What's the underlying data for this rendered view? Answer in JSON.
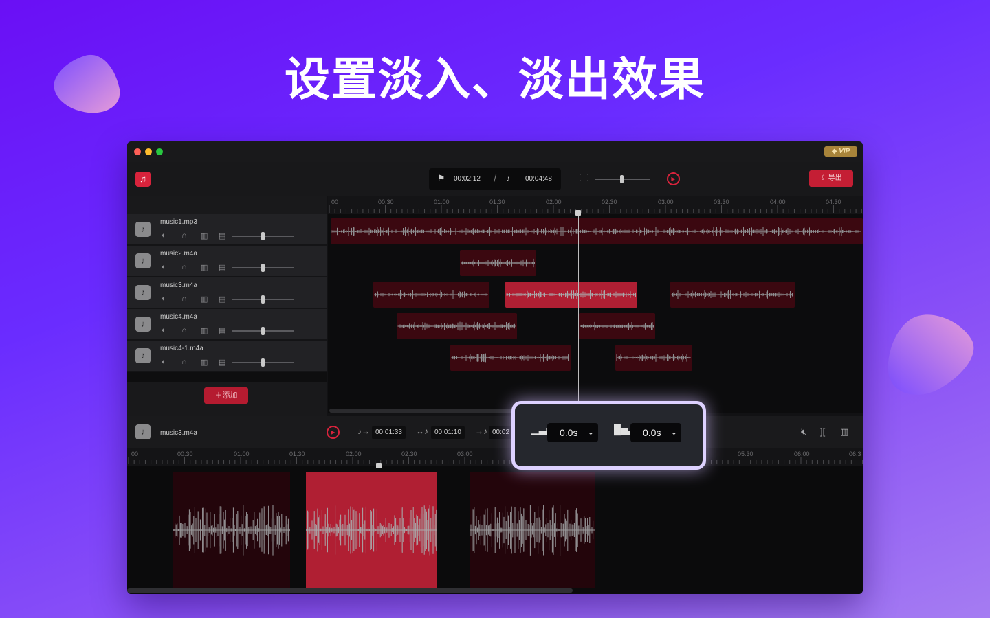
{
  "headline": "设置淡入、淡出效果",
  "window": {
    "vip_badge": "VIP",
    "export_label": "导出",
    "current_time": "00:02:12",
    "time_separator": "/",
    "total_time": "00:04:48"
  },
  "ruler_ticks": [
    "00",
    "00:30",
    "01:00",
    "01:30",
    "02:00",
    "02:30",
    "03:00",
    "03:30",
    "04:00",
    "04:30"
  ],
  "tracks": [
    {
      "name": "music1.mp3"
    },
    {
      "name": "music2.m4a"
    },
    {
      "name": "music3.m4a"
    },
    {
      "name": "music4.m4a"
    },
    {
      "name": "music4-1.m4a"
    }
  ],
  "add_label": "添加",
  "editor": {
    "track_name": "music3.m4a",
    "start_time": "00:01:33",
    "duration": "00:01:10",
    "end_time": "00:02",
    "ruler_ticks": [
      "00",
      "00:30",
      "01:00",
      "01:30",
      "02:00",
      "02:30",
      "03:00",
      "05:30",
      "06:00",
      "06:3"
    ]
  },
  "fade": {
    "fade_in_value": "0.0s",
    "fade_out_value": "0.0s"
  },
  "colors": {
    "accent": "#d8233c",
    "clip_dim": "#3b0810",
    "clip_selected": "#b01f33",
    "popup_border": "#ddd1ff"
  },
  "icons": [
    "music-note-icon",
    "mute-icon",
    "headphones-icon",
    "trash-icon",
    "equalizer-icon",
    "play-icon",
    "export-icon",
    "fade-in-icon",
    "fade-out-icon",
    "split-icon"
  ]
}
